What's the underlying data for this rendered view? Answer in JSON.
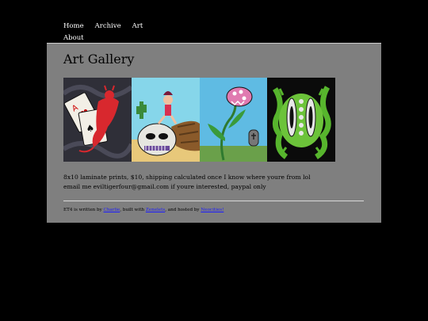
{
  "nav": {
    "items": [
      "Home",
      "Archive",
      "Art",
      "About"
    ]
  },
  "page": {
    "title": "Art Gallery",
    "caption_line1": "8x10 laminate prints, $10, shipping calculated once I know where youre from lol",
    "caption_line2": "email me eviltigerfour@gmail.com if youre interested, paypal only"
  },
  "gallery": {
    "images": [
      {
        "name": "devil-playing-card-painting",
        "bg": "#2b2b33"
      },
      {
        "name": "girl-on-skull-cornucopia-painting",
        "bg": "#7fd3e8"
      },
      {
        "name": "carnivorous-plant-painting",
        "bg": "#5fb8e0"
      },
      {
        "name": "green-eye-creature-painting",
        "bg": "#0d0d0d"
      }
    ]
  },
  "footer": {
    "prefix": "ET4 is written by ",
    "author": "Charlie",
    "mid1": ", built with ",
    "engine": "Zenelets",
    "mid2": ", and hosted by ",
    "host": "Neocities!"
  }
}
